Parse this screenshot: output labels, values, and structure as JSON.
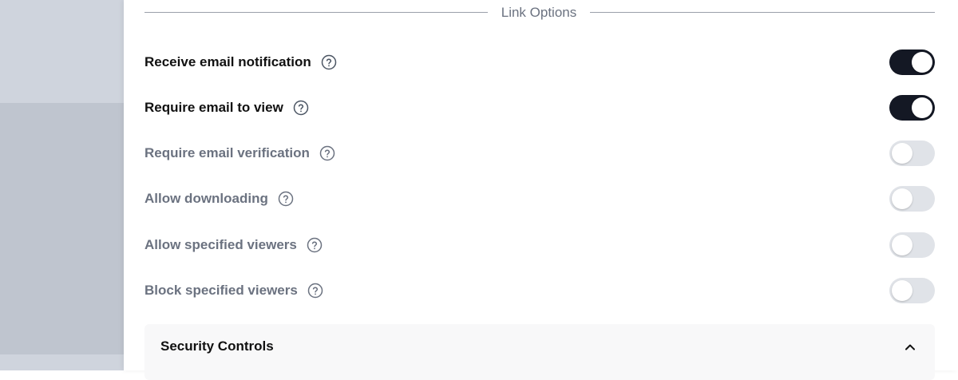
{
  "section": {
    "title": "Link Options"
  },
  "options": [
    {
      "label": "Receive email notification",
      "enabled": true,
      "disabled": false
    },
    {
      "label": "Require email to view",
      "enabled": true,
      "disabled": false
    },
    {
      "label": "Require email verification",
      "enabled": false,
      "disabled": true
    },
    {
      "label": "Allow downloading",
      "enabled": false,
      "disabled": true
    },
    {
      "label": "Allow specified viewers",
      "enabled": false,
      "disabled": true
    },
    {
      "label": "Block specified viewers",
      "enabled": false,
      "disabled": true
    }
  ],
  "accordion": {
    "title": "Security Controls",
    "icon": "chevron-up-icon"
  },
  "colors": {
    "toggle_on": "#141824",
    "toggle_off": "#e0e3e8",
    "text_active": "#111111",
    "text_muted": "#6b7280"
  }
}
